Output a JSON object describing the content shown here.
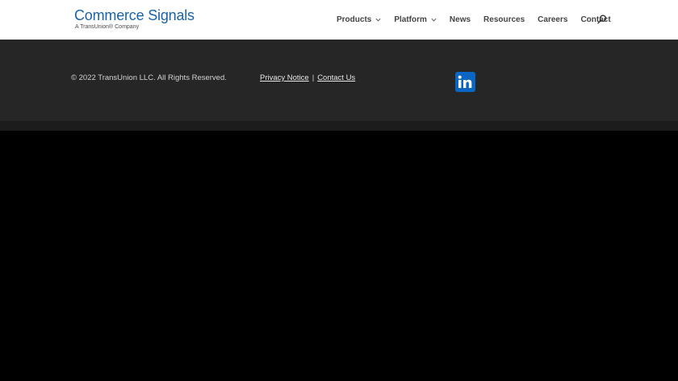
{
  "header": {
    "logo": {
      "main": "Commerce Signals",
      "sub": "A TransUnion® Company"
    },
    "nav": [
      {
        "label": "Products",
        "has_dropdown": true
      },
      {
        "label": "Platform",
        "has_dropdown": true
      },
      {
        "label": "News",
        "has_dropdown": false
      },
      {
        "label": "Resources",
        "has_dropdown": false
      },
      {
        "label": "Careers",
        "has_dropdown": false
      },
      {
        "label": "Contact",
        "has_dropdown": false
      }
    ],
    "search_icon": "search-icon"
  },
  "footer": {
    "copyright": "© 2022 TransUnion LLC. All Rights Reserved.",
    "links": {
      "privacy": "Privacy Notice",
      "separator": "|",
      "contact": "Contact Us"
    },
    "social_icon": "linkedin-icon"
  },
  "colors": {
    "brand_blue": "#1a63a8",
    "linkedin_blue": "#0a66c2",
    "footer_bg": "#262626",
    "page_bg": "#000000"
  }
}
